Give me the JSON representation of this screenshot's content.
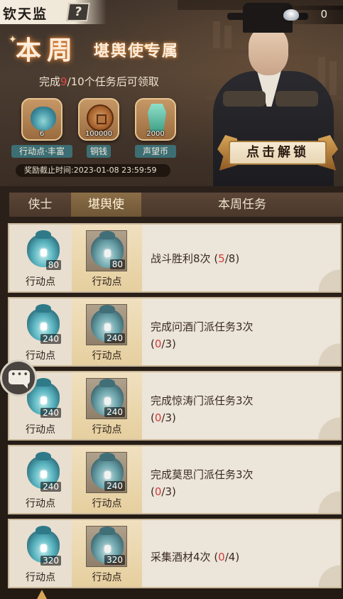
{
  "header": {
    "title": "钦天监",
    "help_symbol": "?",
    "silver_count": "0"
  },
  "banner": {
    "title_big": "本周",
    "title_small": "堪舆使专属",
    "progress_prefix": "完成",
    "progress_done": "9",
    "progress_suffix": "/10个任务后可领取",
    "rewards": [
      {
        "label": "行动点·丰富",
        "amount": "6",
        "icon": "bag-icon"
      },
      {
        "label": "铜钱",
        "amount": "100000",
        "icon": "coin-icon"
      },
      {
        "label": "声望币",
        "amount": "2000",
        "icon": "reputation-icon"
      }
    ],
    "deadline_label": "奖励截止时间:",
    "deadline_value": "2023-01-08  23:59:59",
    "unlock_label": "点击解锁"
  },
  "table": {
    "col_free": "侠士",
    "col_premium": "堪舆使",
    "col_task": "本周任务"
  },
  "tasks": [
    {
      "free_qty": "80",
      "free_label": "行动点",
      "prem_qty": "80",
      "prem_label": "行动点",
      "line1": "战斗胜利8次",
      "line2": "",
      "progress_open": " (",
      "progress_done": "5",
      "progress_total": "/8)",
      "progress_inline": true
    },
    {
      "free_qty": "240",
      "free_label": "行动点",
      "prem_qty": "240",
      "prem_label": "行动点",
      "line1": "完成问酒门派任务3次",
      "progress_open": "(",
      "progress_done": "0",
      "progress_total": "/3)",
      "progress_inline": false
    },
    {
      "free_qty": "240",
      "free_label": "行动点",
      "prem_qty": "240",
      "prem_label": "行动点",
      "line1": "完成惊涛门派任务3次",
      "progress_open": "(",
      "progress_done": "0",
      "progress_total": "/3)",
      "progress_inline": false
    },
    {
      "free_qty": "240",
      "free_label": "行动点",
      "prem_qty": "240",
      "prem_label": "行动点",
      "line1": "完成莫思门派任务3次",
      "progress_open": "(",
      "progress_done": "0",
      "progress_total": "/3)",
      "progress_inline": false
    },
    {
      "free_qty": "320",
      "free_label": "行动点",
      "prem_qty": "320",
      "prem_label": "行动点",
      "line1": "采集酒材4次",
      "progress_open": " (",
      "progress_done": "0",
      "progress_total": "/4)",
      "progress_inline": true
    }
  ],
  "colors": {
    "accent_red": "#d23b3b",
    "premium_column": "#e6cf9f",
    "header_bg": "#4a382b"
  }
}
